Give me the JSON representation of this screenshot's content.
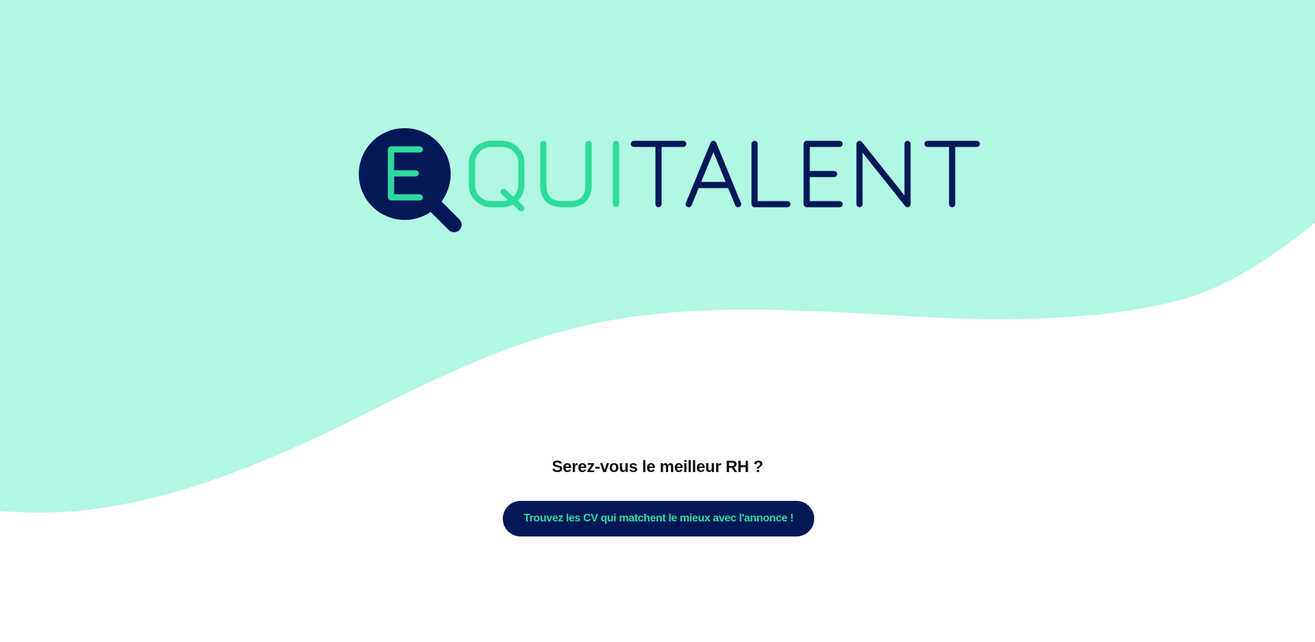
{
  "brand": {
    "name_part_accent": "QUI",
    "name_part_dark": "TALENT",
    "logo_letter": "E",
    "colors": {
      "navy": "#041858",
      "mint_background": "#b1f7e3",
      "accent_green": "#2ddc9c",
      "white": "#ffffff"
    }
  },
  "hero": {
    "tagline": "Serez-vous le meilleur RH ?",
    "cta_label": "Trouvez les CV qui matchent le mieux avec l'annonce !"
  },
  "icons": {
    "logo_mark": "magnifying-glass-icon"
  }
}
